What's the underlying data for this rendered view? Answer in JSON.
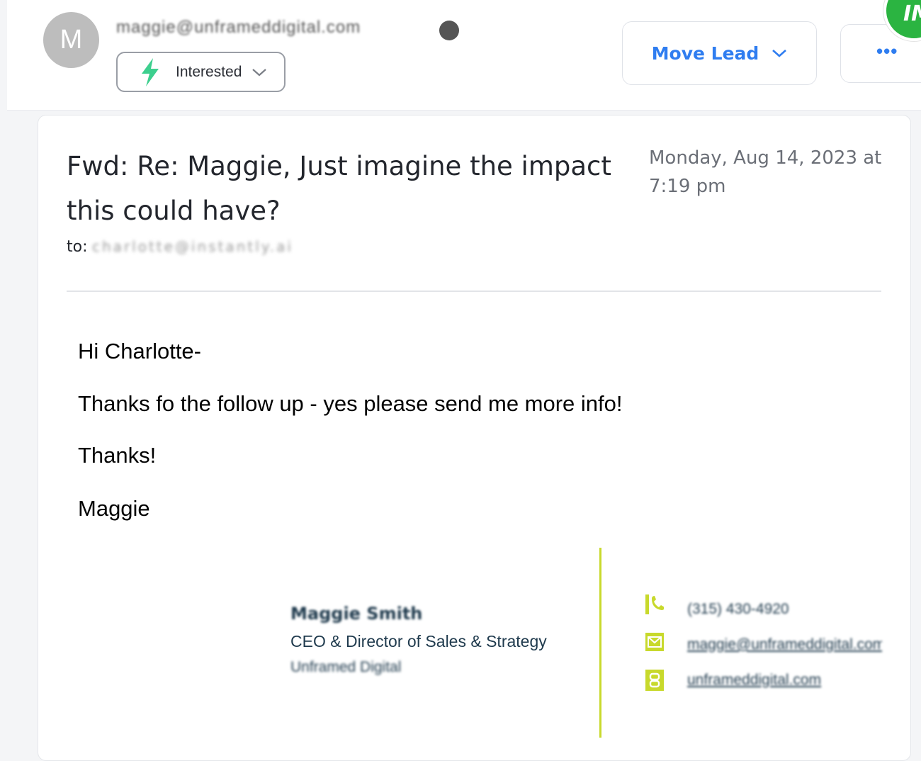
{
  "header": {
    "avatar_letter": "M",
    "sender_email": "maggie@unframeddigital.com",
    "status_label": "Interested",
    "move_lead_label": "Move Lead",
    "more_label": "•••",
    "brand_badge": "IM"
  },
  "email": {
    "subject": "Fwd: Re: Maggie, Just imagine the impact this could have?",
    "date": "Monday, Aug 14, 2023 at 7:19 pm",
    "to_label": "to:",
    "to_value": "charlotte@instantly.ai",
    "body": {
      "greeting": "Hi Charlotte-",
      "line1": "Thanks fo the follow up - yes please send me more info!",
      "line2": "Thanks!",
      "signoff": "Maggie"
    }
  },
  "signature": {
    "name": "Maggie Smith",
    "title": "CEO & Director of Sales & Strategy",
    "company": "Unframed Digital",
    "phone": "(315) 430-4920",
    "email": "maggie@unframeddigital.com",
    "website": "unframeddigital.com"
  },
  "colors": {
    "accent_blue": "#2f7df0",
    "status_green": "#3dcf8e",
    "signature_lime": "#c8d92c",
    "brand_green": "#2bb441"
  }
}
